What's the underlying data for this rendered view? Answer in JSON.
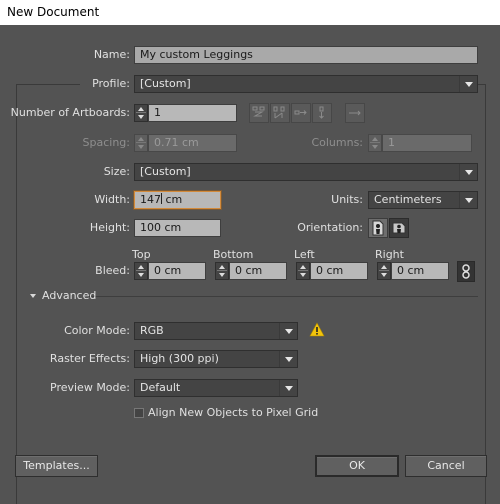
{
  "window": {
    "title": "New Document"
  },
  "name": {
    "label": "Name:",
    "value": "My custom Leggings"
  },
  "profile": {
    "label": "Profile:",
    "value": "[Custom]"
  },
  "artboards": {
    "label": "Number of Artboards:",
    "value": "1",
    "arrangement_icons": [
      "grid-by-row-icon",
      "grid-by-column-icon",
      "arrange-by-row-icon",
      "arrange-by-column-icon",
      "right-to-left-layout-icon"
    ]
  },
  "spacing": {
    "label": "Spacing:",
    "value": "0.71 cm",
    "disabled": true
  },
  "columns": {
    "label": "Columns:",
    "value": "1",
    "disabled": true
  },
  "size": {
    "label": "Size:",
    "value": "[Custom]"
  },
  "width": {
    "label": "Width:",
    "value": "147",
    "unit_suffix": " cm"
  },
  "units": {
    "label": "Units:",
    "value": "Centimeters"
  },
  "height": {
    "label": "Height:",
    "value": "100 cm"
  },
  "orientation": {
    "label": "Orientation:",
    "options": [
      "portrait",
      "landscape"
    ],
    "selected": "portrait"
  },
  "bleed": {
    "label": "Bleed:",
    "top": {
      "label": "Top",
      "value": "0 cm"
    },
    "bottom": {
      "label": "Bottom",
      "value": "0 cm"
    },
    "left": {
      "label": "Left",
      "value": "0 cm"
    },
    "right": {
      "label": "Right",
      "value": "0 cm"
    },
    "link_icon": "chain-link-icon"
  },
  "advanced": {
    "label": "Advanced",
    "expanded": true,
    "color_mode": {
      "label": "Color Mode:",
      "value": "RGB",
      "warning_icon": "warning-icon"
    },
    "raster_effects": {
      "label": "Raster Effects:",
      "value": "High (300 ppi)"
    },
    "preview_mode": {
      "label": "Preview Mode:",
      "value": "Default"
    },
    "pixel_grid": {
      "label": "Align New Objects to Pixel Grid",
      "checked": false
    }
  },
  "buttons": {
    "templates": "Templates...",
    "ok": "OK",
    "cancel": "Cancel"
  },
  "colors": {
    "dialog_bg": "#535353",
    "focus": "#d38a3a",
    "warning": "#f2c40c"
  }
}
